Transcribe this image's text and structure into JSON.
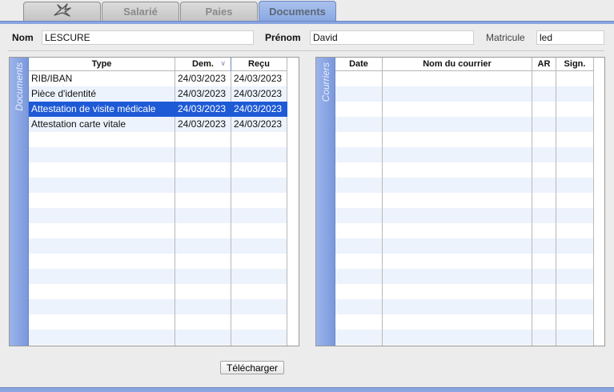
{
  "tabs": {
    "salarie": "Salarié",
    "paies": "Paies",
    "documents": "Documents",
    "active": "documents"
  },
  "header": {
    "nom_label": "Nom",
    "nom_value": "LESCURE",
    "prenom_label": "Prénom",
    "prenom_value": "David",
    "matricule_label": "Matricule",
    "matricule_value": "led"
  },
  "documents_panel": {
    "side_label": "Documents",
    "columns": {
      "type": "Type",
      "dem": "Dem.",
      "recu": "Reçu"
    },
    "sorted_column": "dem",
    "rows": [
      {
        "type": "RIB/IBAN",
        "dem": "24/03/2023",
        "recu": "24/03/2023"
      },
      {
        "type": "Pièce d'identité",
        "dem": "24/03/2023",
        "recu": "24/03/2023"
      },
      {
        "type": "Attestation de visite médicale",
        "dem": "24/03/2023",
        "recu": "24/03/2023"
      },
      {
        "type": "Attestation carte vitale",
        "dem": "24/03/2023",
        "recu": "24/03/2023"
      }
    ],
    "selected_row": 2
  },
  "courriers_panel": {
    "side_label": "Courriers",
    "columns": {
      "date": "Date",
      "nom": "Nom du courrier",
      "ar": "AR",
      "sign": "Sign."
    },
    "rows": []
  },
  "actions": {
    "telecharger": "Télécharger"
  },
  "colors": {
    "accent": "#8aa5e0",
    "selection": "#1e5ad6",
    "stripe": "#edf3fd"
  }
}
